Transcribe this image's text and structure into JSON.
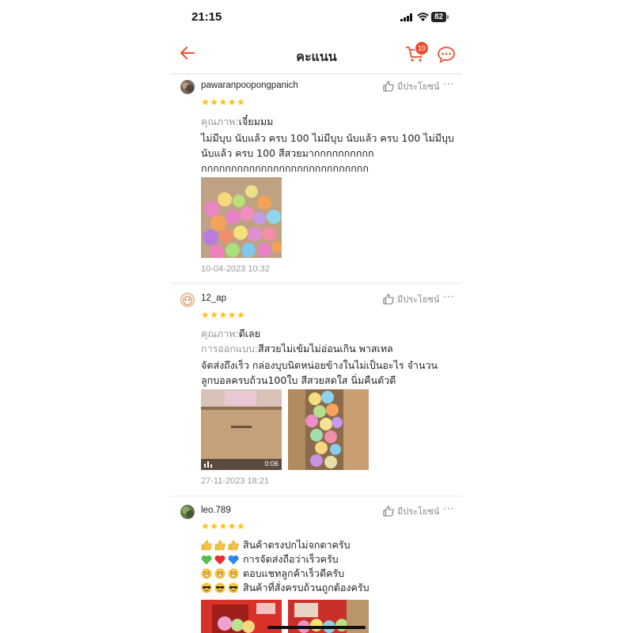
{
  "status_bar": {
    "time": "21:15",
    "battery": "82"
  },
  "header": {
    "title": "คะแนน",
    "cart_count": "10"
  },
  "helpful_label": "มีประโยชน์",
  "more_label": "···",
  "reviews": [
    {
      "username": "pawaranpoopongpanich",
      "stars": "★★★★★",
      "quality_label": "คุณภาพ:",
      "quality_value": "เจี๋ยมมม",
      "text_lines": [
        "ไม่มีบุบ นับแล้ว ครบ 100 ไม่มีบุบ นับแล้ว ครบ 100 ไม่มีบุบ",
        "นับแล้ว ครบ 100  สีสวยมากกกกกกกกกก",
        "กกกกกกกกกกกกกกกกกกกกกกกกกกกก"
      ],
      "date": "10-04-2023 10:32"
    },
    {
      "username": "12_ap",
      "stars": "★★★★★",
      "quality_label": "คุณภาพ:",
      "quality_value": "ดีเลย",
      "design_label": "การออกแบบ:",
      "design_value": "สีสวยไม่เข้มไม่อ่อนเกิน พาสเทล",
      "text_lines": [
        "จัดส่งถึงเร็ว กล่องบุบนิดหน่อยข้างในไม่เป็นอะไร จำนวน",
        "ลูกบอลครบถ้วน100ใบ สีสวยสดใส นิ่มคืนตัวดี"
      ],
      "video_duration": "0:06",
      "date": "27-11-2023 18:21"
    },
    {
      "username": "leo.789",
      "stars": "★★★★★",
      "text_lines": [
        "สินค้าตรงปกไม่จกตาครับ",
        "การจัดส่งถือว่าเร็วครับ",
        "ตอบแชทลูกค้าเร็วดีครับ",
        "สินค้าที่สั่งครบถ้วนถูกต้องครับ"
      ]
    }
  ],
  "colors": {
    "accent": "#ee4d2d",
    "star": "#ffbe17",
    "muted": "#999999"
  },
  "icons": [
    "back-arrow-icon",
    "cart-icon",
    "chat-icon",
    "thumbs-up-icon",
    "more-icon",
    "star-icon",
    "video-bars-icon"
  ]
}
